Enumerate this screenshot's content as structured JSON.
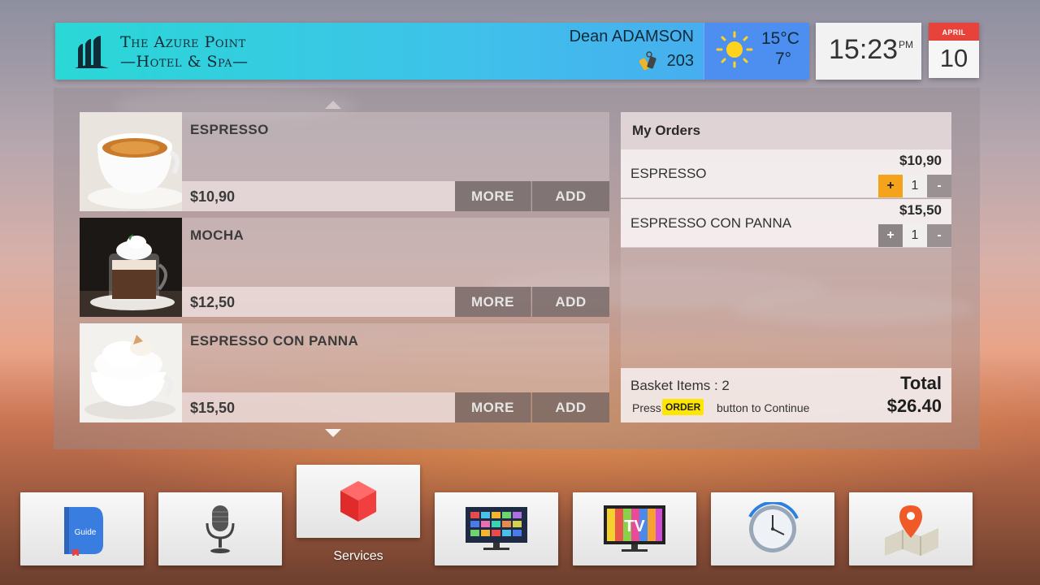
{
  "header": {
    "hotel_line1": "The Azure Point",
    "hotel_line2": "—Hotel & Spa—",
    "guest_name": "Dean ADAMSON",
    "room_number": "203",
    "temp_high": "15°C",
    "temp_low": "7°",
    "time": "15:23",
    "ampm": "PM",
    "month": "APRIL",
    "day": "10"
  },
  "menu": {
    "items": [
      {
        "name": "ESPRESSO",
        "price": "$10,90",
        "more": "MORE",
        "add": "ADD"
      },
      {
        "name": "MOCHA",
        "price": "$12,50",
        "more": "MORE",
        "add": "ADD"
      },
      {
        "name": "ESPRESSO CON PANNA",
        "price": "$15,50",
        "more": "MORE",
        "add": "ADD"
      }
    ]
  },
  "orders": {
    "title": "My Orders",
    "items": [
      {
        "name": "ESPRESSO",
        "price": "$10,90",
        "qty": "1",
        "plus": "+",
        "minus": "-"
      },
      {
        "name": "ESPRESSO CON PANNA",
        "price": "$15,50",
        "qty": "1",
        "plus": "+",
        "minus": "-"
      }
    ],
    "basket_label": "Basket Items : 2",
    "press": "Press",
    "order_badge": "ORDER",
    "continue": "button to Continue",
    "total_label": "Total",
    "total_value": "$26.40"
  },
  "dock": {
    "guide_label": "Guide",
    "active_label": "Services",
    "tv_label": "TV",
    "icons": [
      "guide-book-icon",
      "microphone-icon",
      "services-cube-icon",
      "tv-channels-icon",
      "tv-icon",
      "clock-icon",
      "map-pin-icon"
    ]
  },
  "colors": {
    "header_start": "#2ad8d6",
    "header_end": "#4aa6f2",
    "accent_orange": "#f5a31a",
    "order_badge": "#ffe600",
    "calendar_red": "#e8433a"
  }
}
